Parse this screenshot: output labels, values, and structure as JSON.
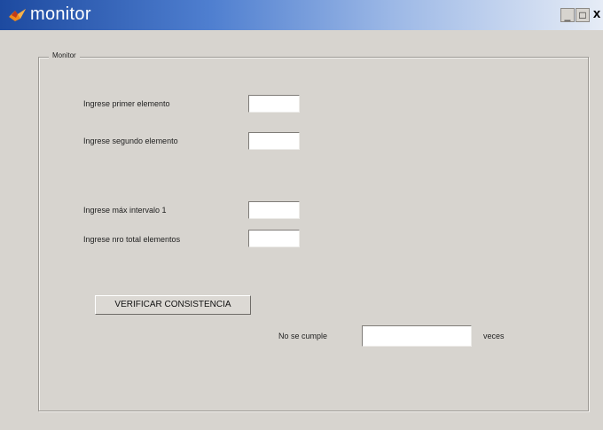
{
  "window": {
    "title": "monitor",
    "buttons": {
      "minimize": "_",
      "maximize": "□",
      "close": "x"
    },
    "title_gradient": [
      "#1d4aa0",
      "#e6ecf6"
    ]
  },
  "panel": {
    "title": "Monitor"
  },
  "fields": {
    "primer_elemento": {
      "label": "Ingrese primer elemento",
      "value": ""
    },
    "segundo_elemento": {
      "label": "Ingrese segundo elemento",
      "value": ""
    },
    "max_intervalo": {
      "label": "Ingrese máx intervalo 1",
      "value": ""
    },
    "nro_total": {
      "label": "Ingrese nro total elementos",
      "value": ""
    }
  },
  "verify_button": {
    "label": "VERIFICAR CONSISTENCIA"
  },
  "result": {
    "prefix": "No se cumple",
    "value": "",
    "suffix": "veces"
  }
}
